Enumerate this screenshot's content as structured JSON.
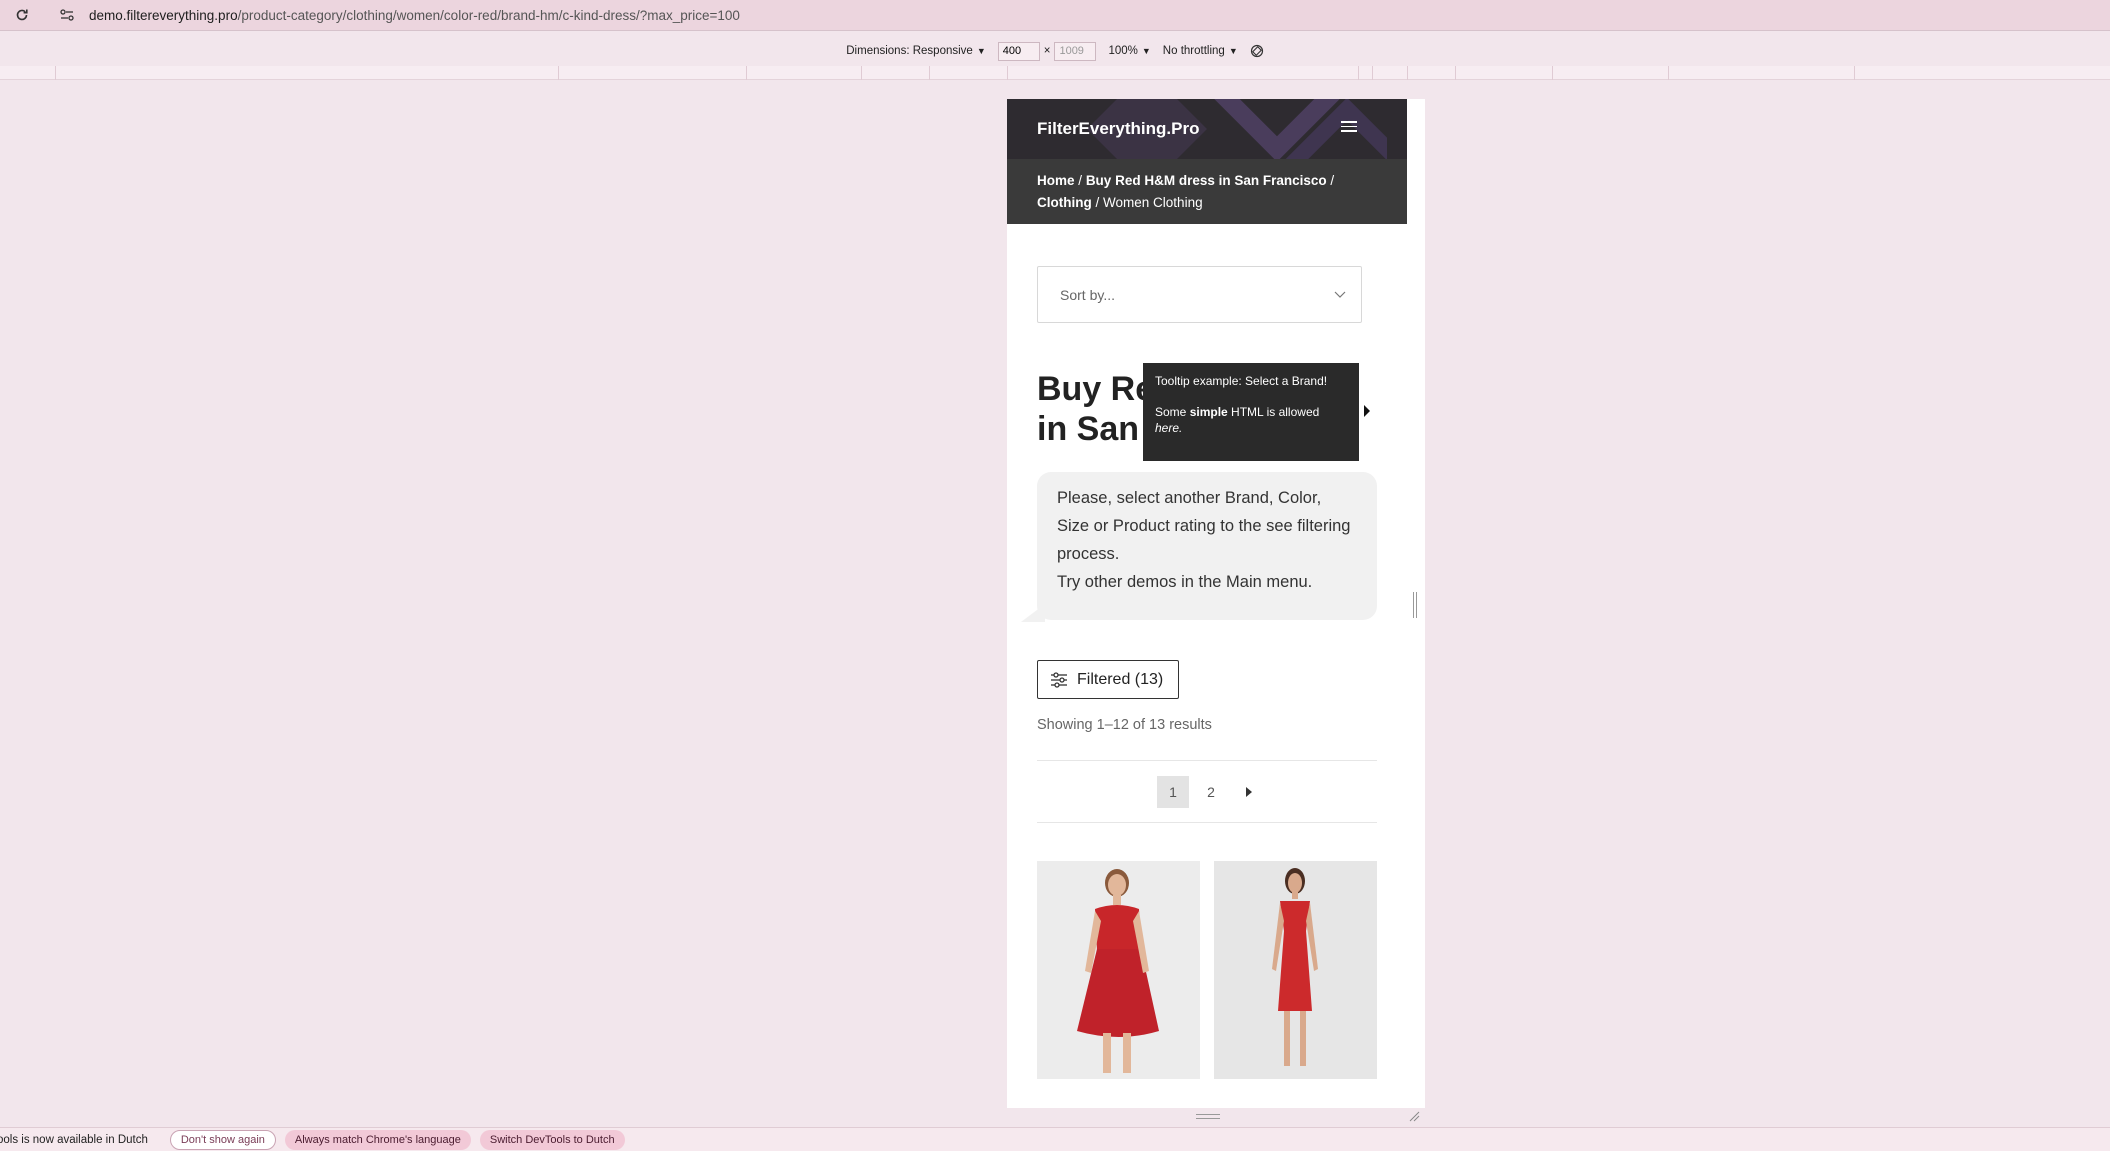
{
  "browser": {
    "url_host": "demo.filtereverything.pro",
    "url_path": "/product-category/clothing/women/color-red/brand-hm/c-kind-dress/?max_price=100"
  },
  "device_toolbar": {
    "dimensions_label": "Dimensions: Responsive",
    "width": "400",
    "height": "1009",
    "zoom": "100%",
    "throttling": "No throttling"
  },
  "site": {
    "brand": "FilterEverything.Pro",
    "breadcrumb": {
      "home": "Home",
      "sep": "/",
      "link1": "Buy Red H&M dress in San Francisco",
      "link2": "Clothing",
      "current": "Women Clothing"
    },
    "sort_placeholder": "Sort by...",
    "title_line1": "Buy Re",
    "title_line2": "in San",
    "tooltip": {
      "line1": "Tooltip example: Select a Brand!",
      "line2_pre": "Some ",
      "line2_bold": "simple",
      "line2_post": " HTML is allowed",
      "line3_italic": "here."
    },
    "notice": {
      "line1": "Please, select another Brand, Color, Size or Product rating to the see filtering process.",
      "line2": "Try other demos in the Main menu."
    },
    "filtered_button": "Filtered (13)",
    "results_text": "Showing 1–12 of 13 results",
    "pagination": [
      "1",
      "2"
    ]
  },
  "infobar": {
    "message": "ools is now available in Dutch",
    "dont_show": "Don't show again",
    "match_language": "Always match Chrome's language",
    "switch": "Switch DevTools to Dutch"
  },
  "colors": {
    "header_bg": "#2e2b30",
    "breadcrumb_bg": "#3a3a3a",
    "chrome_bg": "#ecd5de",
    "dress_red": "#c8262a"
  }
}
